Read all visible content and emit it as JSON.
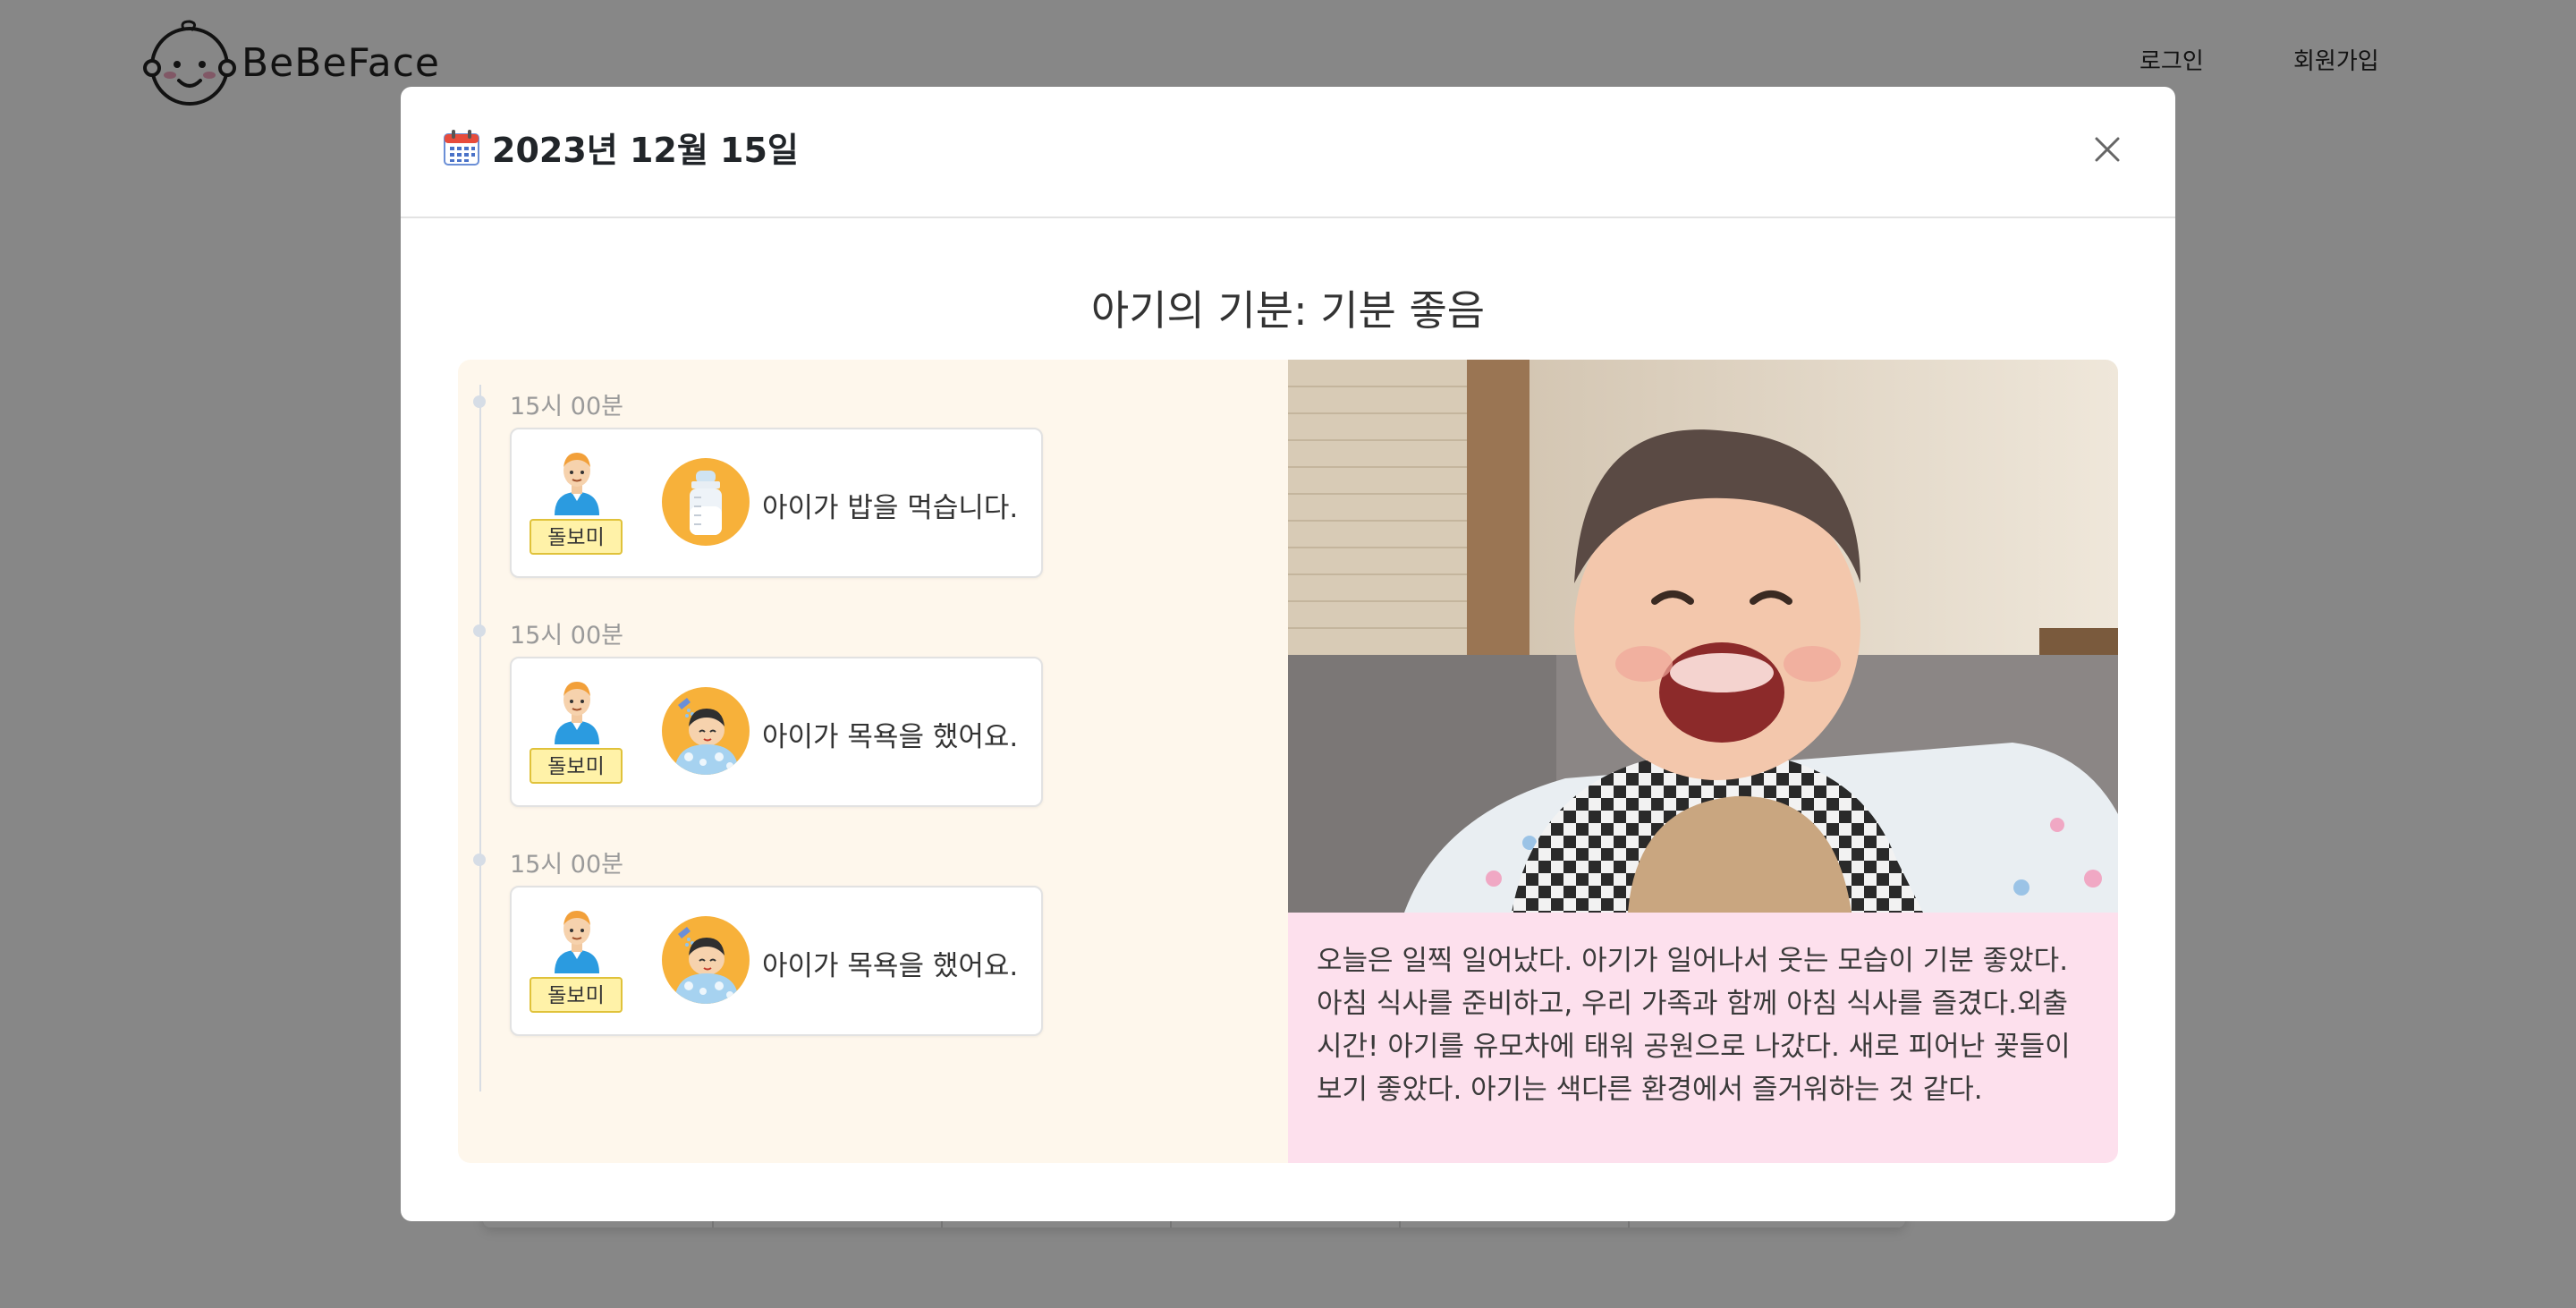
{
  "app": {
    "logo_text": "BeBeFace"
  },
  "nav": {
    "login": "로그인",
    "signup": "회원가입"
  },
  "modal": {
    "date": "2023년 12월 15일",
    "title": "아기의 기분: 기분 좋음",
    "entries": [
      {
        "time": "15시 00분",
        "caregiver": "돌보미",
        "activity": "아이가 밥을 먹습니다.",
        "icon": "baby-bottle-icon"
      },
      {
        "time": "15시 00분",
        "caregiver": "돌보미",
        "activity": "아이가 목욕을 했어요.",
        "icon": "baby-bath-icon"
      },
      {
        "time": "15시 00분",
        "caregiver": "돌보미",
        "activity": "아이가 목욕을 했어요.",
        "icon": "baby-bath-icon"
      }
    ],
    "diary": "오늘은 일찍 일어났다. 아기가 일어나서 웃는 모습이 기분 좋았다. 아침 식사를 준비하고, 우리 가족과 함께 아침 식사를 즐겼다.외출 시간! 아기를 유모차에 태워 공원으로 나갔다. 새로 피어난 꽃들이 보기 좋았다. 아기는 색다른 환경에서 즐거워하는 것 같다."
  },
  "colors": {
    "timeline_bg": "#fef7ec",
    "diary_bg": "#fde0ed",
    "badge_bg": "#fff2a8",
    "activity_icon_bg": "#f7b13a",
    "overlay": "rgba(0,0,0,0.47)"
  }
}
